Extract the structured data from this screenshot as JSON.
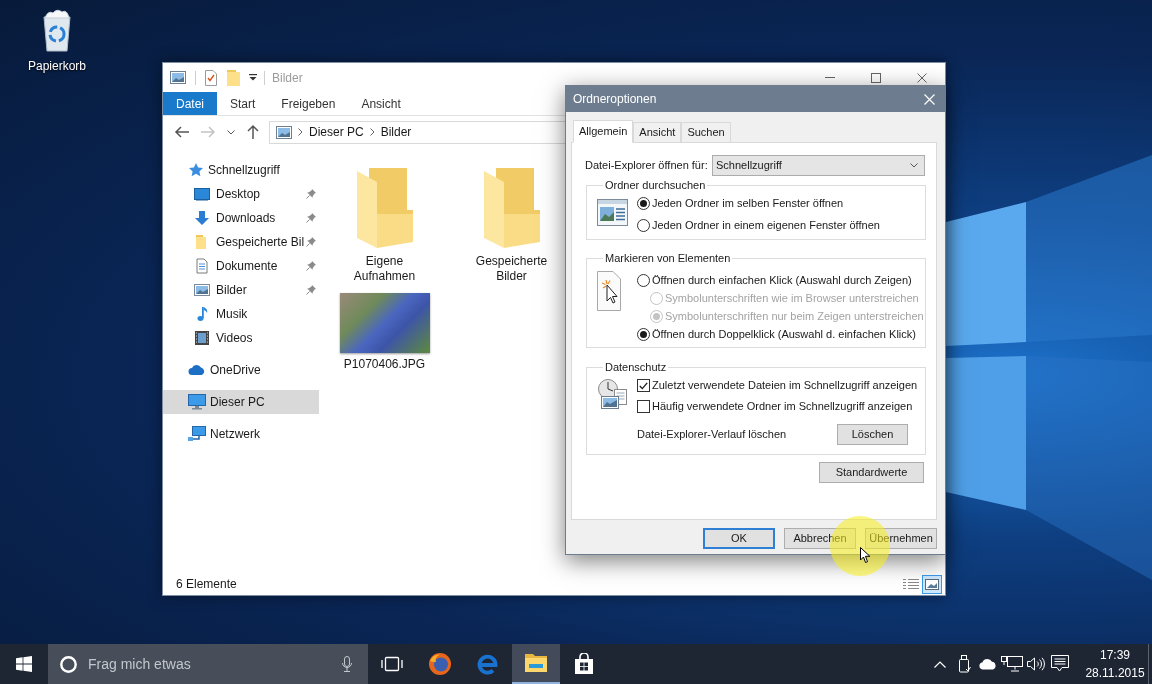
{
  "desktop": {
    "icons": [
      {
        "label": "Papierkorb",
        "kind": "recycle-bin"
      }
    ]
  },
  "explorer": {
    "title": "Bilder",
    "ribbon_tabs": [
      {
        "label": "Datei",
        "selected": true
      },
      {
        "label": "Start",
        "selected": false
      },
      {
        "label": "Freigeben",
        "selected": false
      },
      {
        "label": "Ansicht",
        "selected": false
      }
    ],
    "navigation_buttons": [
      {
        "kind": "back",
        "disabled": false
      },
      {
        "kind": "forward",
        "disabled": true
      },
      {
        "kind": "recent",
        "disabled": false
      },
      {
        "kind": "up",
        "disabled": false
      }
    ],
    "breadcrumb": [
      "Dieser PC",
      "Bilder"
    ],
    "navigation": [
      {
        "label": "Schnellzugriff",
        "kind": "quick-access",
        "selected": false,
        "children": [
          {
            "label": "Desktop",
            "kind": "desktop",
            "pinned": true,
            "selected": false
          },
          {
            "label": "Downloads",
            "kind": "downloads",
            "pinned": true,
            "selected": false
          },
          {
            "label": "Gespeicherte Bil",
            "kind": "folder",
            "pinned": true,
            "selected": false
          },
          {
            "label": "Dokumente",
            "kind": "documents",
            "pinned": true,
            "selected": false
          },
          {
            "label": "Bilder",
            "kind": "pictures",
            "pinned": true,
            "selected": false
          },
          {
            "label": "Musik",
            "kind": "music",
            "pinned": false,
            "selected": false
          },
          {
            "label": "Videos",
            "kind": "videos",
            "pinned": false,
            "selected": false
          }
        ]
      },
      {
        "label": "OneDrive",
        "kind": "cloud",
        "selected": false
      },
      {
        "label": "Dieser PC",
        "kind": "computer",
        "selected": true
      },
      {
        "label": "Netzwerk",
        "kind": "network",
        "selected": false
      }
    ],
    "items": [
      {
        "label": "Eigene Aufnahmen",
        "kind": "folder"
      },
      {
        "label": "Gespeicherte Bilder",
        "kind": "folder"
      },
      {
        "label": "P1070406.JPG",
        "kind": "photo"
      }
    ],
    "status": "6 Elemente",
    "view_modes": [
      {
        "kind": "details",
        "selected": false
      },
      {
        "kind": "large-icons",
        "selected": true
      }
    ]
  },
  "dialog": {
    "title": "Ordneroptionen",
    "tabs": [
      {
        "label": "Allgemein",
        "selected": true
      },
      {
        "label": "Ansicht",
        "selected": false
      },
      {
        "label": "Suchen",
        "selected": false
      }
    ],
    "open_for": {
      "label": "Datei-Explorer öffnen für:",
      "value": "Schnellzugriff"
    },
    "groups": [
      {
        "title": "Ordner durchsuchen",
        "kind": "browse",
        "options": [
          {
            "kind": "radio",
            "label": "Jeden Ordner im selben Fenster öffnen",
            "selected": true,
            "disabled": false
          },
          {
            "kind": "radio",
            "label": "Jeden Ordner in einem eigenen Fenster öffnen",
            "selected": false,
            "disabled": false
          }
        ]
      },
      {
        "title": "Markieren von Elementen",
        "kind": "click",
        "options": [
          {
            "kind": "radio",
            "label": "Öffnen durch einfachen Klick (Auswahl durch Zeigen)",
            "selected": false,
            "disabled": false,
            "children": [
              {
                "kind": "radio",
                "label": "Symbolunterschriften wie im Browser unterstreichen",
                "selected": false,
                "disabled": true
              },
              {
                "kind": "radio",
                "label": "Symbolunterschriften nur beim Zeigen unterstreichen",
                "selected": true,
                "disabled": true
              }
            ]
          },
          {
            "kind": "radio",
            "label": "Öffnen durch Doppelklick (Auswahl d. einfachen Klick)",
            "selected": true,
            "disabled": false
          }
        ]
      },
      {
        "title": "Datenschutz",
        "kind": "privacy",
        "options": [
          {
            "kind": "checkbox",
            "label": "Zuletzt verwendete Dateien im Schnellzugriff anzeigen",
            "checked": true
          },
          {
            "kind": "checkbox",
            "label": "Häufig verwendete Ordner im Schnellzugriff anzeigen",
            "checked": false
          },
          {
            "kind": "action",
            "label": "Datei-Explorer-Verlauf löschen",
            "button": "Löschen"
          }
        ]
      }
    ],
    "defaults_button": "Standardwerte",
    "buttons": [
      {
        "label": "OK",
        "default": true
      },
      {
        "label": "Abbrechen",
        "default": false
      },
      {
        "label": "Übernehmen",
        "default": false
      }
    ]
  },
  "taskbar": {
    "search": {
      "placeholder": "Frag mich etwas"
    },
    "apps": [
      {
        "kind": "task-view",
        "active": false
      },
      {
        "kind": "firefox",
        "active": false
      },
      {
        "kind": "edge",
        "active": false
      },
      {
        "kind": "file-explorer",
        "active": true
      },
      {
        "kind": "store",
        "active": false
      }
    ],
    "clock": {
      "time": "17:39",
      "date": "28.11.2015"
    }
  }
}
